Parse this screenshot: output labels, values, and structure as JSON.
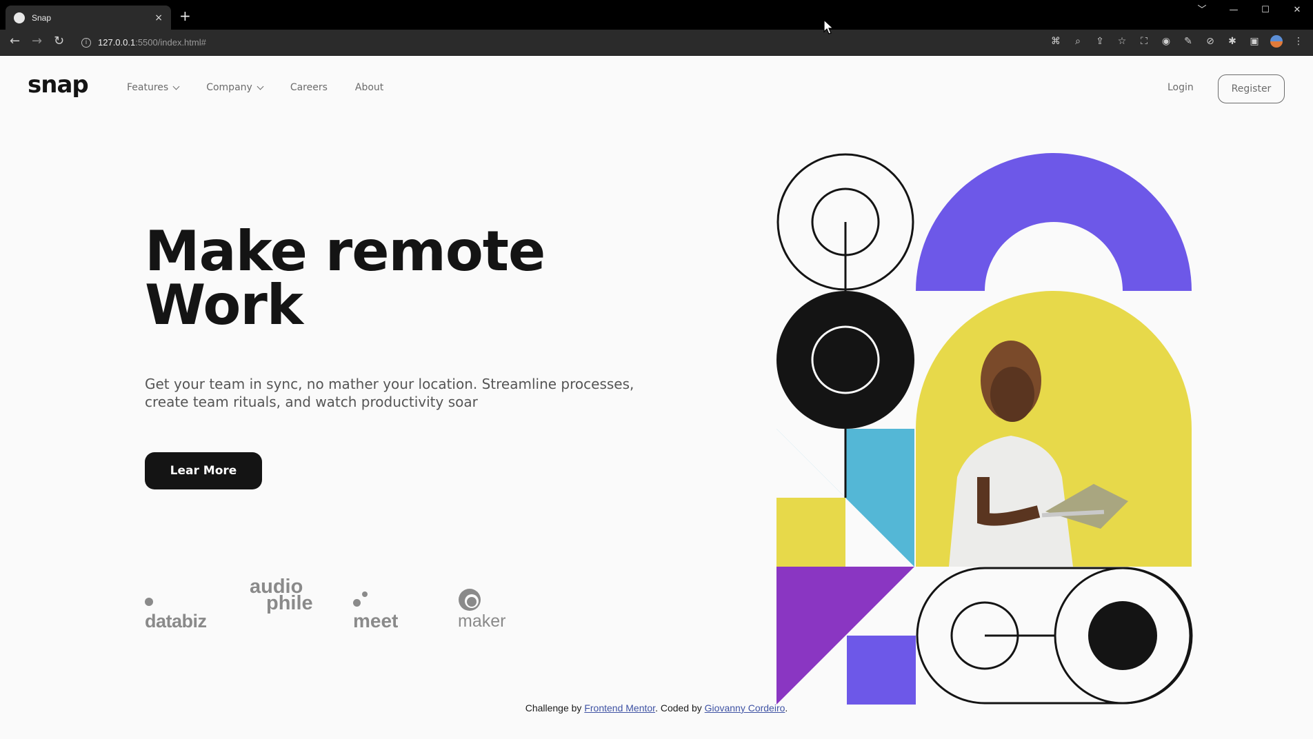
{
  "browser": {
    "tab_title": "Snap",
    "tab_close": "×",
    "new_tab": "+",
    "url_host": "127.0.0.1",
    "url_path": ":5500/index.html#",
    "window_controls": [
      "﹀",
      "—",
      "☐",
      "✕"
    ]
  },
  "header": {
    "logo": "snap",
    "nav": [
      {
        "label": "Features",
        "has_dropdown": true
      },
      {
        "label": "Company",
        "has_dropdown": true
      },
      {
        "label": "Careers",
        "has_dropdown": false
      },
      {
        "label": "About",
        "has_dropdown": false
      }
    ],
    "login": "Login",
    "register": "Register"
  },
  "hero": {
    "title_line1": "Make remote",
    "title_line2": "Work",
    "subtitle": "Get your team in sync, no mather your location. Streamline processes, create team rituals, and watch productivity soar",
    "cta": "Lear More"
  },
  "clients": {
    "databiz": "databiz",
    "audiophile_top": "audio",
    "audiophile_bottom": "phile",
    "meet": "meet",
    "maker": "maker"
  },
  "art": {
    "colors": {
      "purple": "#6d58e8",
      "yellow": "#e7d94a",
      "cyan": "#54b7d6",
      "violet": "#8a36c2",
      "black": "#141414"
    }
  },
  "footer": {
    "prefix": "Challenge by ",
    "link1": "Frontend Mentor",
    "middle": ". Coded by ",
    "link2": "Giovanny Cordeiro",
    "suffix": "."
  }
}
